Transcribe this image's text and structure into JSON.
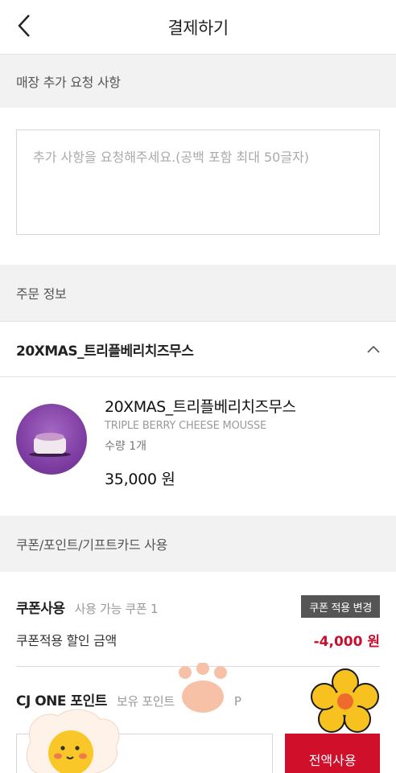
{
  "header": {
    "title": "결제하기"
  },
  "request": {
    "section_title": "매장 추가 요청 사항",
    "placeholder": "추가 사항을 요청해주세요.(공백 포함 최대 50글자)"
  },
  "order": {
    "section_title": "주문 정보",
    "product_header": "20XMAS_트리플베리치즈무스",
    "item": {
      "name": "20XMAS_트리플베리치즈무스",
      "english_name": "TRIPLE BERRY CHEESE MOUSSE",
      "quantity": "수량 1개",
      "price": "35,000 원"
    }
  },
  "discounts": {
    "section_title": "쿠폰/포인트/기프트카드 사용",
    "coupon_label": "쿠폰사용",
    "coupon_available": "사용 가능 쿠폰 1",
    "coupon_change_button": "쿠폰 적용 변경",
    "coupon_discount_label": "쿠폰적용 할인 금액",
    "coupon_discount_value": "-4,000 원",
    "cj_label": "CJ ONE 포인트",
    "cj_points_partial": "보유 포인트",
    "cj_points_tail": "P",
    "use_all_button": "전액사용"
  },
  "colors": {
    "accent_red": "#d0102a",
    "discount_red": "#c8102e",
    "band_gray": "#f2f2f2"
  },
  "icons": {
    "back": "chevron-left-icon",
    "collapse": "chevron-up-icon"
  }
}
